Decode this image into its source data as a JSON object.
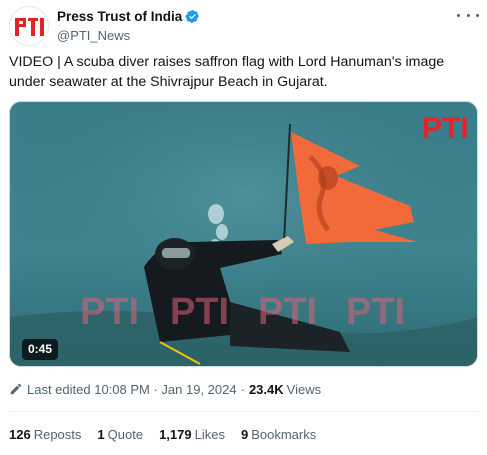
{
  "author": {
    "name": "Press Trust of India",
    "handle": "@PTI_News",
    "verified_color": "#1d9bf0"
  },
  "tweet": {
    "text": "VIDEO | A scuba diver raises saffron flag with Lord Hanuman's image under seawater at the Shivrajpur Beach in Gujarat."
  },
  "media": {
    "duration": "0:45",
    "watermark": "PTI",
    "water_color": "#3b7a88",
    "flag_color": "#f26a3a"
  },
  "meta": {
    "edited": "Last edited 10:08 PM · Jan 19, 2024",
    "separator": "·",
    "views_count": "23.4K",
    "views_label": "Views"
  },
  "stats": {
    "reposts_count": "126",
    "reposts_label": "Reposts",
    "quotes_count": "1",
    "quotes_label": "Quote",
    "likes_count": "1,179",
    "likes_label": "Likes",
    "bookmarks_count": "9",
    "bookmarks_label": "Bookmarks"
  }
}
